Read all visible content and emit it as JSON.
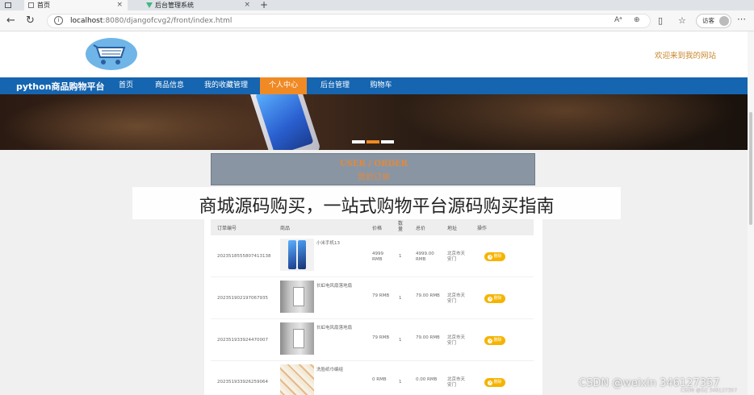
{
  "browser": {
    "tabs": [
      {
        "title": "首页"
      },
      {
        "title": "后台管理系统"
      }
    ],
    "url_host": "localhost",
    "url_path": ":8080/djangofcvg2/front/index.html",
    "reader_label": "Aᵃ",
    "guest_label": "访客"
  },
  "site": {
    "welcome": "欢迎来到我的网站",
    "brand": "python商品购物平台",
    "nav": [
      "首页",
      "商品信息",
      "我的收藏管理",
      "个人中心",
      "后台管理",
      "购物车"
    ],
    "active_nav": "个人中心"
  },
  "order_panel": {
    "title_en": "USER / ORDER",
    "title_cn": "我的订单"
  },
  "overlay": {
    "text": "商城源码购买，一站式购物平台源码购买指南"
  },
  "table": {
    "headers": [
      "订单编号",
      "商品",
      "价格",
      "数量",
      "总价",
      "地址",
      "操作"
    ],
    "rows": [
      {
        "order_no": "202351855580741313​8",
        "product": "小米手机13",
        "price": "4999 RMB",
        "qty": "1",
        "total": "4999.00 RMB",
        "address": "北京市天安门",
        "action": "删除",
        "img": "phone"
      },
      {
        "order_no": "20235190219706793​5",
        "product": "长虹电风扇落地扇",
        "price": "79 RMB",
        "qty": "1",
        "total": "79.00 RMB",
        "address": "北京市天安门",
        "action": "删除",
        "img": "room"
      },
      {
        "order_no": "20235193392447000​7",
        "product": "长虹电风扇落地扇",
        "price": "79 RMB",
        "qty": "1",
        "total": "79.00 RMB",
        "address": "北京市天安门",
        "action": "删除",
        "img": "room"
      },
      {
        "order_no": "20235193392625906​4",
        "product": "洗脸纸巾编组",
        "price": "0 RMB",
        "qty": "1",
        "total": "0.00 RMB",
        "address": "北京市天安门",
        "action": "删除",
        "img": "food"
      }
    ]
  },
  "watermark": {
    "main": "CSDN @weixin 346127357",
    "sub": "CSDN @GZ 346127357"
  },
  "colors": {
    "nav_blue": "#1565b0",
    "nav_active": "#f08a24",
    "delete_btn": "#f5b400",
    "welcome": "#c8862a"
  }
}
